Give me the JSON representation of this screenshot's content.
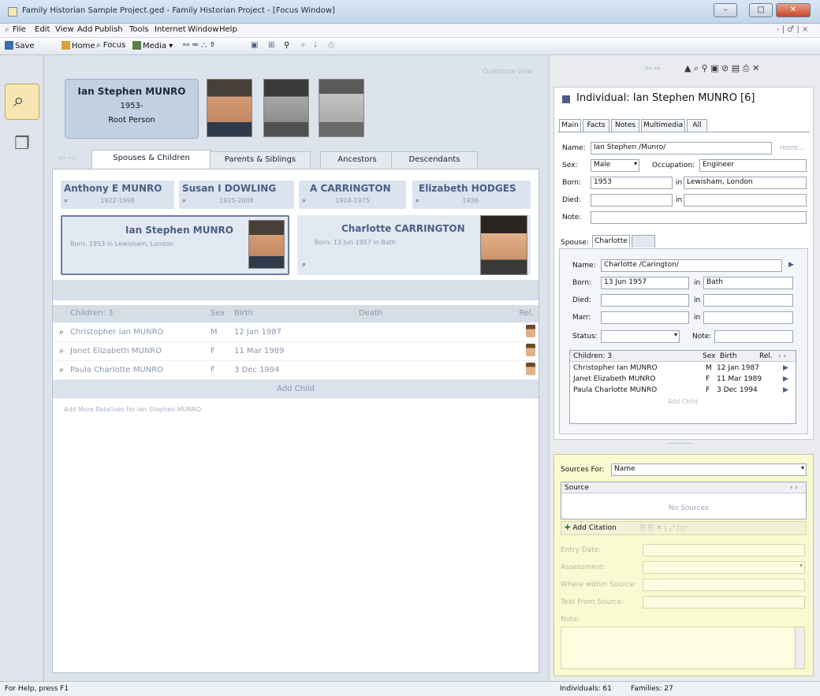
{
  "window": {
    "title": "Family Historian Sample Project.ged - Family Historian Project - [Focus Window]",
    "min": "–",
    "max": "□",
    "close": "✕",
    "mdi_controls": "- | ♂ | ×"
  },
  "menu": [
    "File",
    "Edit",
    "View",
    "Add",
    "Publish",
    "Tools",
    "Internet",
    "Window",
    "Help"
  ],
  "toolbar": {
    "save": "Save",
    "home": "Home",
    "focus": "Focus",
    "media": "Media"
  },
  "focus": {
    "customize": "Customize View",
    "root": {
      "name": "Ian Stephen MUNRO",
      "years": "1953-",
      "role": "Root Person"
    },
    "tabs": [
      "Spouses & Children",
      "Parents & Siblings",
      "Ancestors",
      "Descendants"
    ],
    "parents": [
      {
        "name": "Anthony E MUNRO",
        "dates": "1922-1998"
      },
      {
        "name": "Susan I DOWLING",
        "dates": "1925-2008"
      },
      {
        "name": "A CARRINGTON",
        "dates": "1924-1975"
      },
      {
        "name": "Elizabeth HODGES",
        "dates": "1936-"
      }
    ],
    "couple": [
      {
        "name": "Ian Stephen MUNRO",
        "born_label": "Born:",
        "born": "1953 in Lewisham, London"
      },
      {
        "name": "Charlotte CARRINGTON",
        "born_label": "Born:",
        "born": "13 Jun 1957 in Bath"
      }
    ],
    "children_header": {
      "name": "Children: 3",
      "sex": "Sex",
      "birth": "Birth",
      "death": "Death",
      "rel": "Rel."
    },
    "children": [
      {
        "name": "Christopher Ian MUNRO",
        "sex": "M",
        "birth": "12 Jan 1987"
      },
      {
        "name": "Janet Elizabeth MUNRO",
        "sex": "F",
        "birth": "11 Mar 1989"
      },
      {
        "name": "Paula Charlotte MUNRO",
        "sex": "F",
        "birth": "3 Dec 1994"
      }
    ],
    "add_child": "Add Child",
    "add_more": "Add More Relatives for Ian Stephen MUNRO"
  },
  "props": {
    "title": "Individual: Ian Stephen MUNRO [6]",
    "tabs": [
      "Main",
      "Facts",
      "Notes",
      "Multimedia",
      "All"
    ],
    "name_label": "Name:",
    "name": "Ian Stephen /Munro/",
    "more": "more...",
    "sex_label": "Sex:",
    "sex": "Male",
    "occ_label": "Occupation:",
    "occupation": "Engineer",
    "born_label": "Born:",
    "born": "1953",
    "in_label": "in",
    "born_place": "Lewisham, London",
    "died_label": "Died:",
    "note_label": "Note:",
    "spouse_label": "Spouse:",
    "spouse_tab": "Charlotte",
    "sp_name_label": "Name:",
    "sp_name": "Charlotte /Carington/",
    "sp_born": "13 Jun 1957",
    "sp_born_place": "Bath",
    "marr_label": "Marr:",
    "status_label": "Status:",
    "children_header": {
      "name": "Children: 3",
      "sex": "Sex",
      "birth": "Birth",
      "rel": "Rel."
    },
    "children": [
      {
        "name": "Christopher Ian MUNRO",
        "sex": "M",
        "birth": "12 Jan 1987"
      },
      {
        "name": "Janet Elizabeth MUNRO",
        "sex": "F",
        "birth": "11 Mar 1989"
      },
      {
        "name": "Paula Charlotte MUNRO",
        "sex": "F",
        "birth": "3 Dec 1994"
      }
    ],
    "add_child": "Add Child"
  },
  "sources": {
    "label": "Sources For:",
    "for": "Name",
    "col": "Source",
    "empty": "No Sources",
    "add": "Add Citation",
    "entry_date": "Entry Date:",
    "assessment": "Assessment:",
    "where": "Where within Source:",
    "text": "Text From Source:",
    "note": "Note:"
  },
  "status": {
    "help": "For Help, press F1",
    "individuals": "Individuals: 61",
    "families": "Families: 27"
  },
  "colors": {
    "accent": "#4a5f86",
    "focus_bg": "#dde3ec",
    "sources_bg": "#fafad2"
  }
}
